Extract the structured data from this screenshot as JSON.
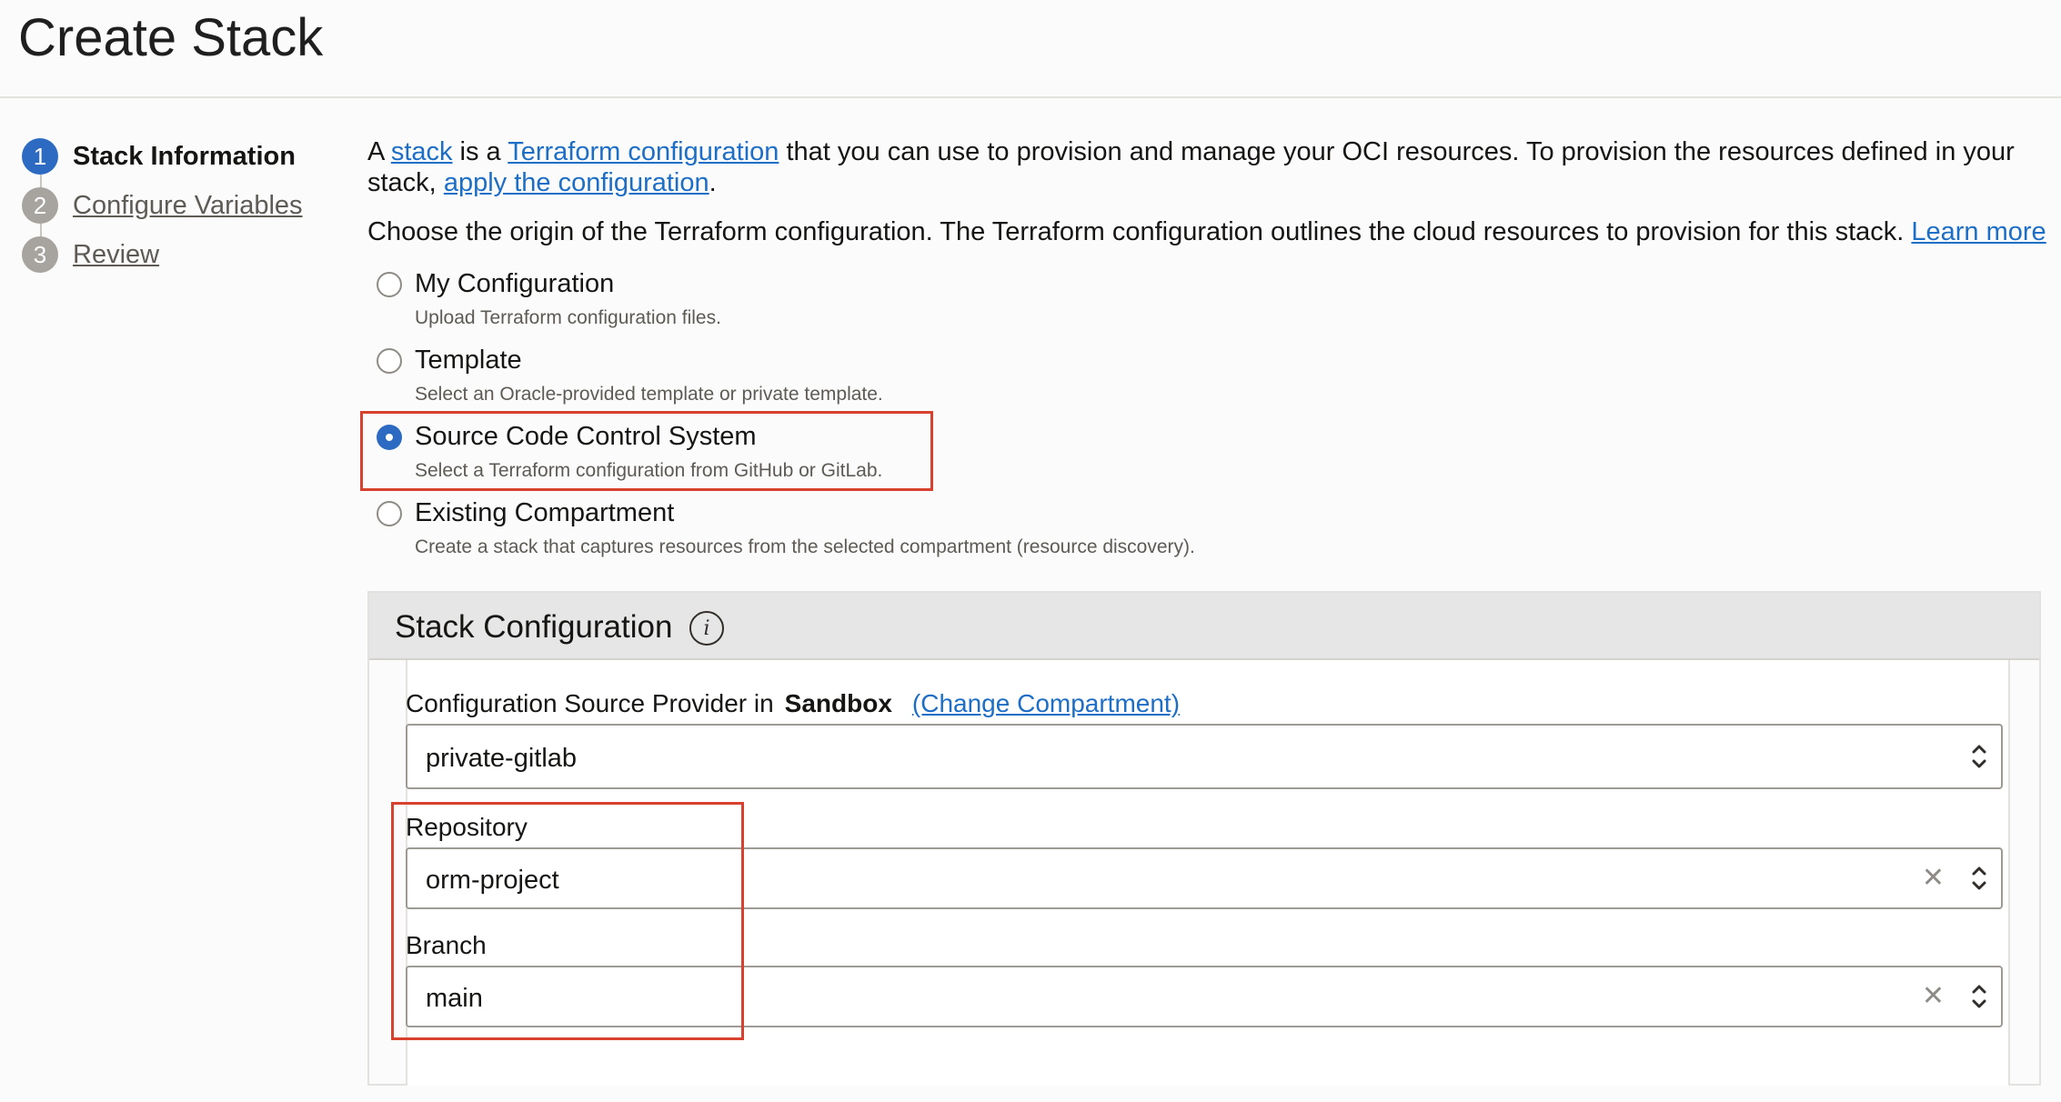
{
  "page": {
    "title": "Create Stack"
  },
  "steps": [
    {
      "number": "1",
      "label": "Stack Information",
      "active": true
    },
    {
      "number": "2",
      "label": "Configure Variables",
      "active": false
    },
    {
      "number": "3",
      "label": "Review",
      "active": false
    }
  ],
  "intro": {
    "p1_a": "A ",
    "p1_link_stack": "stack",
    "p1_b": " is a ",
    "p1_link_terraform": "Terraform configuration",
    "p1_c": " that you can use to provision and manage your OCI resources. To provision the resources defined in your stack, ",
    "p1_link_apply": "apply the configuration",
    "p1_d": ".",
    "p2_text": "Choose the origin of the Terraform configuration. The Terraform configuration outlines the cloud resources to provision for this stack. ",
    "p2_link": "Learn more"
  },
  "origin_options": [
    {
      "label": "My Configuration",
      "description": "Upload Terraform configuration files.",
      "selected": false
    },
    {
      "label": "Template",
      "description": "Select an Oracle-provided template or private template.",
      "selected": false
    },
    {
      "label": "Source Code Control System",
      "description": "Select a Terraform configuration from GitHub or GitLab.",
      "selected": true
    },
    {
      "label": "Existing Compartment",
      "description": "Create a stack that captures resources from the selected compartment (resource discovery).",
      "selected": false
    }
  ],
  "stack_config": {
    "title": "Stack Configuration",
    "info_icon": "info-icon",
    "provider_label": "Configuration Source Provider in",
    "compartment": "Sandbox",
    "change_link": "(Change Compartment)",
    "provider_value": "private-gitlab",
    "repository_label": "Repository",
    "repository_value": "orm-project",
    "branch_label": "Branch",
    "branch_value": "main"
  },
  "colors": {
    "accent": "#2d6bc3",
    "link": "#1c6ec7",
    "highlight": "#d9412f"
  }
}
